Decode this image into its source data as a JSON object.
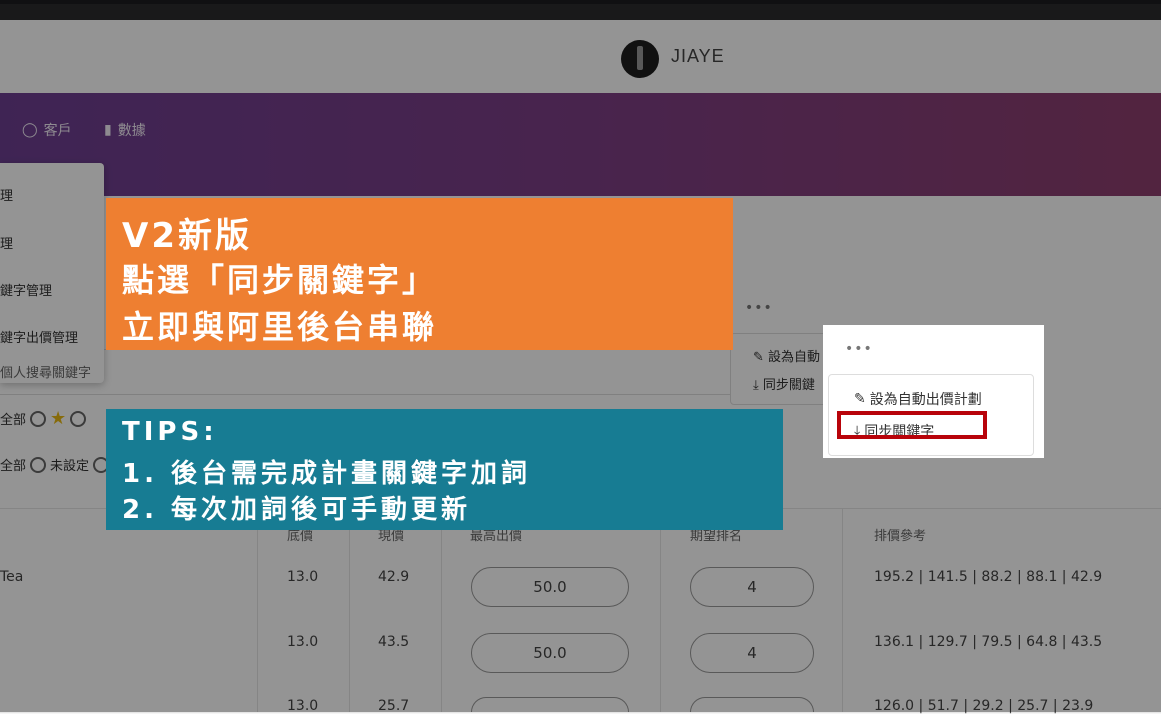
{
  "header": {
    "brand": "JIAYE"
  },
  "nav": {
    "customers": "客戶",
    "data": "數據"
  },
  "dropdown": {
    "items": [
      "理",
      "理",
      "鍵字管理",
      "鍵字出價管理",
      "個人搜尋關鍵字"
    ]
  },
  "actions": {
    "dots": "•••",
    "menu_bg": {
      "auto_bid": "設為自動",
      "sync": "同步關鍵"
    },
    "zoom_menu": {
      "auto_bid": "設為自動出價計劃",
      "sync": "同步關鍵字"
    }
  },
  "filters": {
    "row1": {
      "all": "全部"
    },
    "row2": {
      "all": "全部",
      "unset": "未設定"
    }
  },
  "table": {
    "headers": [
      "底價",
      "現價",
      "最高出價",
      "期望排名",
      "排價參考"
    ],
    "rows": [
      {
        "name": "Tea",
        "base": "13.0",
        "current": "42.9",
        "max_bid": "50.0",
        "rank": "4",
        "ref": "195.2 | 141.5 | 88.2 | 88.1 | 42.9"
      },
      {
        "name": "",
        "base": "13.0",
        "current": "43.5",
        "max_bid": "50.0",
        "rank": "4",
        "ref": "136.1 | 129.7 | 79.5 | 64.8 | 43.5"
      },
      {
        "name": "",
        "base": "13.0",
        "current": "25.7",
        "max_bid": "",
        "rank": "",
        "ref": "126.0 | 51.7 | 29.2 | 25.7 | 23.9"
      }
    ]
  },
  "banner_orange": {
    "line1": "V2新版",
    "line2": "點選「同步關鍵字」",
    "line3": "立即與阿里後台串聯"
  },
  "banner_blue": {
    "line1": "TIPS:",
    "line2": "1. 後台需完成計畫關鍵字加詞",
    "line3": "2. 每次加詞後可手動更新"
  }
}
